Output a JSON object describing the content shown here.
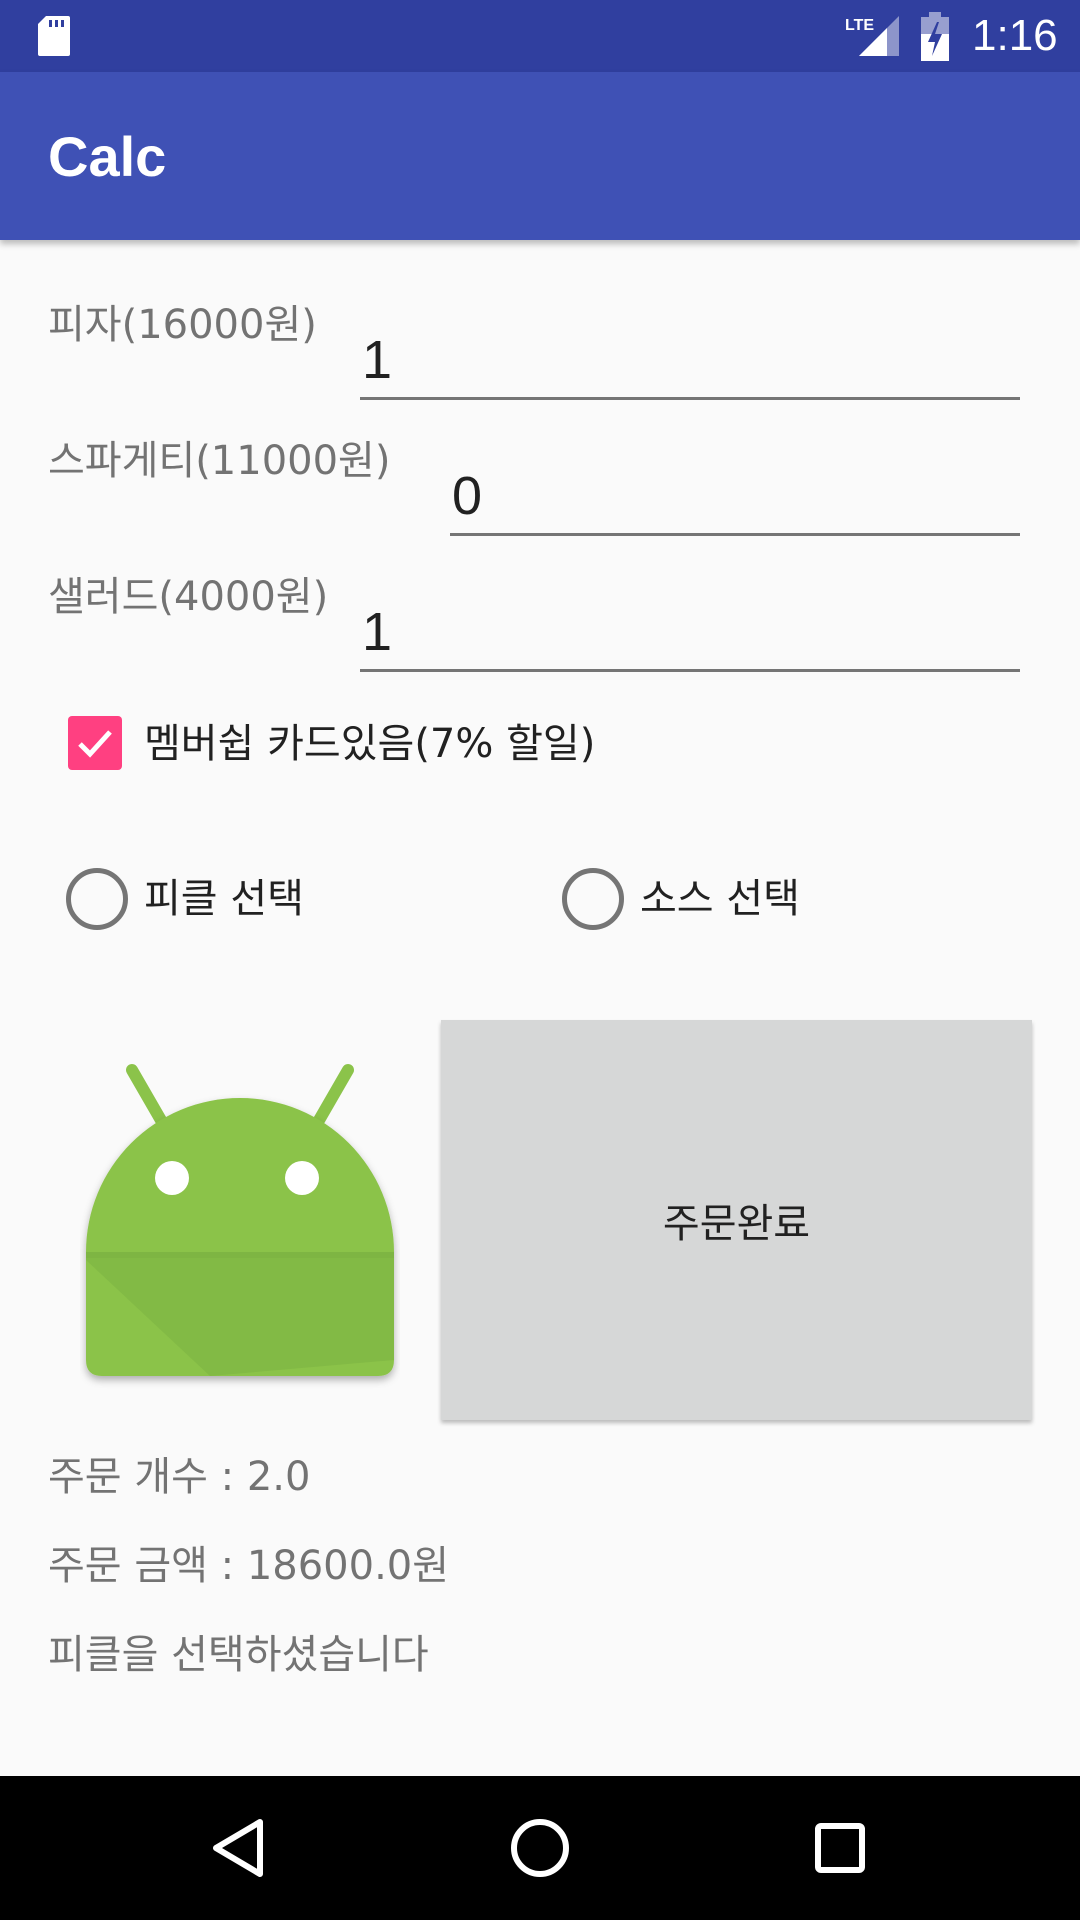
{
  "status_bar": {
    "time": "1:16",
    "network": "LTE",
    "icons": [
      "sd-card-icon",
      "lte-signal-icon",
      "battery-charging-icon"
    ],
    "background": "#303f9f"
  },
  "app_bar": {
    "title": "Calc",
    "background": "#3f51b5"
  },
  "form": {
    "pizza": {
      "label": "피자(16000원)",
      "value": "1"
    },
    "spaghetti": {
      "label": "스파게티(11000원)",
      "value": "0"
    },
    "salad": {
      "label": "샐러드(4000원)",
      "value": "1"
    },
    "membership": {
      "label": "멤버쉽 카드있음(7% 할일)",
      "checked": true,
      "accent": "#ff4081"
    },
    "radios": [
      {
        "label": "피클 선택",
        "selected": false
      },
      {
        "label": "소스 선택",
        "selected": false
      }
    ]
  },
  "image": {
    "icon": "android-robot-icon",
    "color": "#8bc34a"
  },
  "order_button": {
    "label": "주문완료",
    "background": "#d6d7d7"
  },
  "results": {
    "count": "주문 개수 : 2.0",
    "amount": "주문 금액 : 18600.0원",
    "message": "피클을 선택하셨습니다"
  },
  "nav_bar": {
    "icons": [
      "back-triangle-icon",
      "home-circle-icon",
      "recents-square-icon"
    ]
  }
}
